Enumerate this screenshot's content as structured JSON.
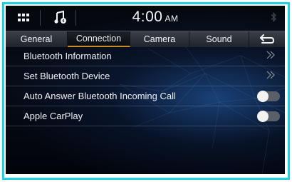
{
  "status_bar": {
    "time": "4:00",
    "ampm": "AM"
  },
  "tabs": [
    {
      "label": "General"
    },
    {
      "label": "Connection"
    },
    {
      "label": "Camera"
    },
    {
      "label": "Sound"
    }
  ],
  "active_tab": "Connection",
  "settings": {
    "items": [
      {
        "label": "Bluetooth Information"
      },
      {
        "label": "Set Bluetooth Device"
      },
      {
        "label": "Auto Answer Bluetooth Incoming Call",
        "toggle": "off"
      },
      {
        "label": "Apple CarPlay",
        "toggle": "off"
      }
    ]
  },
  "colors": {
    "frame_border": "#1fd0e6",
    "active_tab_underline": "#c98a2c",
    "background": "#05070d"
  },
  "icons": {
    "apps": "grid-icon",
    "music": "music-note-icon",
    "bluetooth": "bluetooth-icon",
    "back": "back-arrow-icon",
    "chevron": "double-chevron-right-icon"
  }
}
